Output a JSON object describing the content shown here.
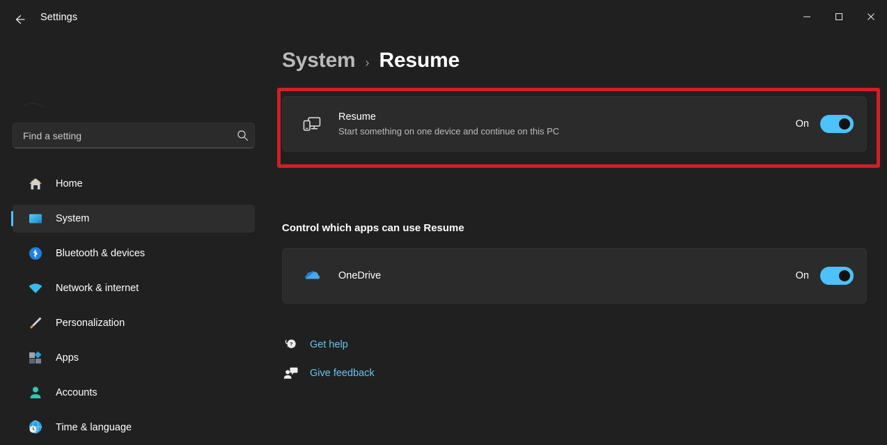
{
  "window": {
    "app_title": "Settings",
    "back_icon": "back-arrow-icon",
    "minimize_label": "—",
    "maximize_label": "☐",
    "close_label": "✕"
  },
  "sidebar": {
    "search": {
      "placeholder": "Find a setting",
      "value": "",
      "icon": "search-icon"
    },
    "items": [
      {
        "label": "Home",
        "icon": "home-icon",
        "selected": false
      },
      {
        "label": "System",
        "icon": "monitor-icon",
        "selected": true
      },
      {
        "label": "Bluetooth & devices",
        "icon": "bluetooth-icon",
        "selected": false
      },
      {
        "label": "Network & internet",
        "icon": "wifi-icon",
        "selected": false
      },
      {
        "label": "Personalization",
        "icon": "paintbrush-icon",
        "selected": false
      },
      {
        "label": "Apps",
        "icon": "apps-icon",
        "selected": false
      },
      {
        "label": "Accounts",
        "icon": "person-icon",
        "selected": false
      },
      {
        "label": "Time & language",
        "icon": "clock-globe-icon",
        "selected": false
      }
    ]
  },
  "content": {
    "breadcrumb": {
      "parent": "System",
      "separator": "›",
      "current": "Resume"
    },
    "resume_card": {
      "icon": "phone-monitor-icon",
      "title": "Resume",
      "subtitle": "Start something on one device and continue on this PC",
      "toggle_label": "On",
      "toggle_state": "on",
      "highlighted": true
    },
    "section_header": "Control which apps can use Resume",
    "apps": [
      {
        "name": "OneDrive",
        "icon": "onedrive-cloud-icon",
        "toggle_label": "On",
        "toggle_state": "on"
      }
    ],
    "links": [
      {
        "label": "Get help",
        "icon": "help-question-bubble-icon"
      },
      {
        "label": "Give feedback",
        "icon": "feedback-person-bubble-icon"
      }
    ]
  },
  "colors": {
    "accent": "#4cc2ff",
    "highlight_border": "#cf2026",
    "link": "#68c3f0",
    "page_bg": "#202020",
    "card_bg": "#2b2b2b"
  }
}
